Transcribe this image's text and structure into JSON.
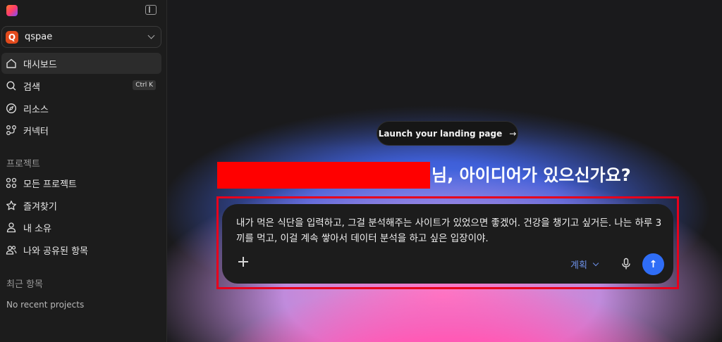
{
  "workspace": {
    "initial": "Q",
    "name": "qspae"
  },
  "nav": {
    "dashboard": "대시보드",
    "search": "검색",
    "search_shortcut": "Ctrl K",
    "resources": "리소스",
    "connectors": "커넥터"
  },
  "projects": {
    "section_title": "프로젝트",
    "all_projects": "모든 프로젝트",
    "favorites": "즐겨찾기",
    "mine": "내 소유",
    "shared": "나와 공유된 항목"
  },
  "recent": {
    "section_title": "최근 항목",
    "empty_text": "No recent projects"
  },
  "main": {
    "launch_pill": "Launch your landing page",
    "launch_arrow": "→",
    "headline": "님, 아이디어가 있으신가요?",
    "prompt_text": "내가 먹은 식단을 입력하고, 그걸 분석해주는 사이트가 있었으면 좋겠어. 건강을 챙기고 싶거든. 나는 하루 3끼를 먹고, 이걸 계속 쌓아서 데이터 분석을 하고 싶은 입장이야.",
    "plan_label": "계획",
    "send_arrow": "↑"
  },
  "colors": {
    "accent_blue": "#2f6df6",
    "plan_blue": "#6c8fe6",
    "redaction": "#ff0000",
    "highlight_border": "#e8001c",
    "workspace_avatar": "#e24a1c"
  },
  "icons": [
    "logo-icon",
    "sidebar-toggle-icon",
    "chevron-down-icon",
    "home-icon",
    "search-icon",
    "compass-icon",
    "connector-icon",
    "grid-icon",
    "star-icon",
    "user-icon",
    "users-icon",
    "plus-icon",
    "microphone-icon",
    "arrow-up-icon",
    "arrow-right-icon"
  ]
}
